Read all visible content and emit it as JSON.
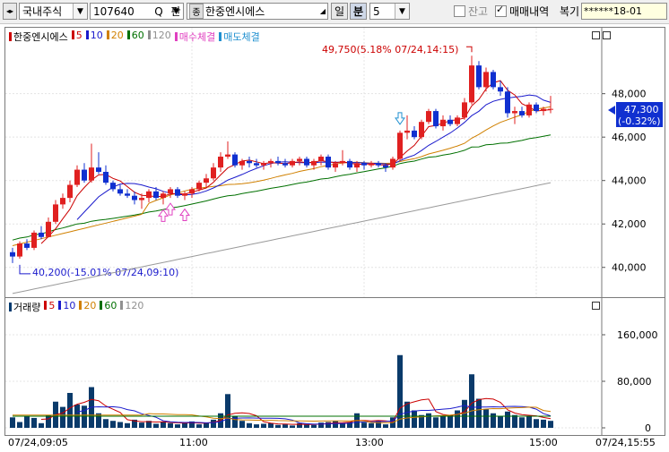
{
  "toolbar": {
    "market": "국내주식",
    "code": "107640",
    "search_label": "Q",
    "pan_label": "판",
    "stock_badge": "종",
    "stock_name": "한중엔시에스",
    "period_day": "일",
    "period_min": "분",
    "interval": "5",
    "balance_label": "잔고",
    "balance_checked": false,
    "trade_history_label": "매매내역",
    "trade_history_checked": true,
    "restore_label": "복기",
    "account_mask": "******18-01"
  },
  "price_chart": {
    "legend": [
      {
        "label": "한중엔시에스",
        "color": "#cc0000"
      },
      {
        "label": "5",
        "color": "#cc0000"
      },
      {
        "label": "10",
        "color": "#1a1acc"
      },
      {
        "label": "20",
        "color": "#d08000"
      },
      {
        "label": "60",
        "color": "#007000"
      },
      {
        "label": "120",
        "color": "#909090"
      },
      {
        "label": "매수체결",
        "color": "#e040c0"
      },
      {
        "label": "매도체결",
        "color": "#2090d0"
      }
    ],
    "high_annotation": "49,750(5.18% 07/24,14:15)",
    "low_annotation": "40,200(-15.01% 07/24,09:10)",
    "y_ticks": [
      "48,000",
      "46,000",
      "44,000",
      "42,000",
      "40,000"
    ],
    "current_price": "47,300",
    "current_change": "(-0.32%)"
  },
  "volume_chart": {
    "legend": [
      {
        "label": "거래량",
        "color": "#003a70"
      },
      {
        "label": "5",
        "color": "#cc0000"
      },
      {
        "label": "10",
        "color": "#1a1acc"
      },
      {
        "label": "20",
        "color": "#d08000"
      },
      {
        "label": "60",
        "color": "#007000"
      },
      {
        "label": "120",
        "color": "#909090"
      }
    ],
    "y_ticks": [
      "160,000",
      "80,000",
      "0"
    ]
  },
  "x_axis": {
    "start": "07/24,09:05",
    "t1": "11:00",
    "t2": "13:00",
    "t3": "15:00",
    "end": "07/24,15:55"
  },
  "colors": {
    "up": "#e02020",
    "down": "#1030d0",
    "volume": "#0a3a6a"
  },
  "chart_data": {
    "type": "candlestick",
    "price_range": [
      39000,
      49800
    ],
    "candles": [
      [
        40700,
        40900,
        40200,
        40500
      ],
      [
        40500,
        41200,
        40400,
        41100
      ],
      [
        41100,
        41300,
        40800,
        40900
      ],
      [
        40900,
        41700,
        40800,
        41600
      ],
      [
        41600,
        41900,
        41300,
        41400
      ],
      [
        41400,
        42300,
        41400,
        42100
      ],
      [
        42100,
        43100,
        42000,
        42900
      ],
      [
        42900,
        43400,
        42700,
        43200
      ],
      [
        43200,
        44000,
        43000,
        43800
      ],
      [
        43800,
        44700,
        43700,
        44500
      ],
      [
        44500,
        44800,
        43900,
        44000
      ],
      [
        44000,
        45700,
        43900,
        44600
      ],
      [
        44600,
        45300,
        44300,
        44400
      ],
      [
        44400,
        44700,
        43800,
        43900
      ],
      [
        43900,
        44000,
        43500,
        43600
      ],
      [
        43600,
        43800,
        43300,
        43400
      ],
      [
        43400,
        43600,
        43200,
        43300
      ],
      [
        43300,
        43500,
        42900,
        43100
      ],
      [
        43100,
        43400,
        42700,
        43200
      ],
      [
        43200,
        43600,
        43000,
        43500
      ],
      [
        43500,
        43700,
        43100,
        43200
      ],
      [
        43200,
        43500,
        42900,
        43400
      ],
      [
        43400,
        43700,
        43200,
        43600
      ],
      [
        43600,
        43700,
        43200,
        43300
      ],
      [
        43300,
        43500,
        43100,
        43400
      ],
      [
        43400,
        43700,
        43200,
        43600
      ],
      [
        43600,
        44000,
        43500,
        43900
      ],
      [
        43900,
        44300,
        43700,
        44100
      ],
      [
        44100,
        44800,
        44000,
        44600
      ],
      [
        44600,
        45300,
        44400,
        45100
      ],
      [
        45100,
        45800,
        45000,
        45200
      ],
      [
        45200,
        45300,
        44600,
        44700
      ],
      [
        44700,
        45000,
        44500,
        44900
      ],
      [
        44900,
        45100,
        44600,
        44800
      ],
      [
        44800,
        45000,
        44600,
        44700
      ],
      [
        44700,
        44900,
        44500,
        44800
      ],
      [
        44800,
        45000,
        44600,
        44900
      ],
      [
        44900,
        45100,
        44700,
        44800
      ],
      [
        44800,
        45000,
        44600,
        44700
      ],
      [
        44700,
        45000,
        44600,
        44900
      ],
      [
        44900,
        45100,
        44700,
        45000
      ],
      [
        45000,
        45100,
        44600,
        44700
      ],
      [
        44700,
        45000,
        44500,
        44900
      ],
      [
        44900,
        45200,
        44700,
        45100
      ],
      [
        45100,
        45200,
        44500,
        44600
      ],
      [
        44600,
        44900,
        44400,
        44800
      ],
      [
        44800,
        45400,
        44700,
        44900
      ],
      [
        44900,
        45000,
        44500,
        44600
      ],
      [
        44600,
        44900,
        44400,
        44800
      ],
      [
        44800,
        44900,
        44500,
        44700
      ],
      [
        44700,
        44900,
        44600,
        44800
      ],
      [
        44800,
        44900,
        44600,
        44700
      ],
      [
        44700,
        44800,
        44400,
        44600
      ],
      [
        44600,
        45100,
        44500,
        45000
      ],
      [
        45000,
        46300,
        44900,
        46200
      ],
      [
        46200,
        47000,
        45900,
        46300
      ],
      [
        46300,
        46500,
        45900,
        46000
      ],
      [
        46000,
        46800,
        45900,
        46700
      ],
      [
        46700,
        47300,
        46600,
        47200
      ],
      [
        47200,
        47300,
        46400,
        46500
      ],
      [
        46500,
        47000,
        46300,
        46800
      ],
      [
        46800,
        47000,
        46500,
        46600
      ],
      [
        46600,
        47000,
        46500,
        46900
      ],
      [
        46900,
        47800,
        46800,
        47600
      ],
      [
        47600,
        49750,
        47500,
        49300
      ],
      [
        49300,
        49500,
        48200,
        48300
      ],
      [
        48300,
        49200,
        48100,
        49000
      ],
      [
        49000,
        49100,
        48200,
        48300
      ],
      [
        48300,
        48600,
        47900,
        48100
      ],
      [
        48100,
        48300,
        46900,
        47100
      ],
      [
        47100,
        47400,
        46600,
        47200
      ],
      [
        47200,
        47400,
        46900,
        47000
      ],
      [
        47000,
        47600,
        46900,
        47500
      ],
      [
        47500,
        47600,
        47100,
        47200
      ],
      [
        47200,
        47400,
        47000,
        47300
      ],
      [
        47300,
        47900,
        47100,
        47300
      ]
    ],
    "volumes": [
      18000,
      10000,
      20000,
      17000,
      8000,
      22000,
      45000,
      36000,
      60000,
      40000,
      38000,
      70000,
      25000,
      15000,
      12000,
      10000,
      8000,
      14000,
      9000,
      12000,
      7000,
      10000,
      8000,
      6000,
      9000,
      11000,
      6000,
      8000,
      14000,
      25000,
      58000,
      20000,
      12000,
      8000,
      6000,
      7000,
      8000,
      5000,
      6000,
      4000,
      8000,
      6000,
      5000,
      9000,
      10000,
      12000,
      8000,
      10000,
      25000,
      9000,
      8000,
      12000,
      6000,
      18000,
      125000,
      45000,
      30000,
      22000,
      25000,
      18000,
      20000,
      22000,
      30000,
      48000,
      92000,
      50000,
      32000,
      25000,
      20000,
      28000,
      22000,
      18000,
      20000,
      15000,
      14000,
      12000
    ]
  }
}
